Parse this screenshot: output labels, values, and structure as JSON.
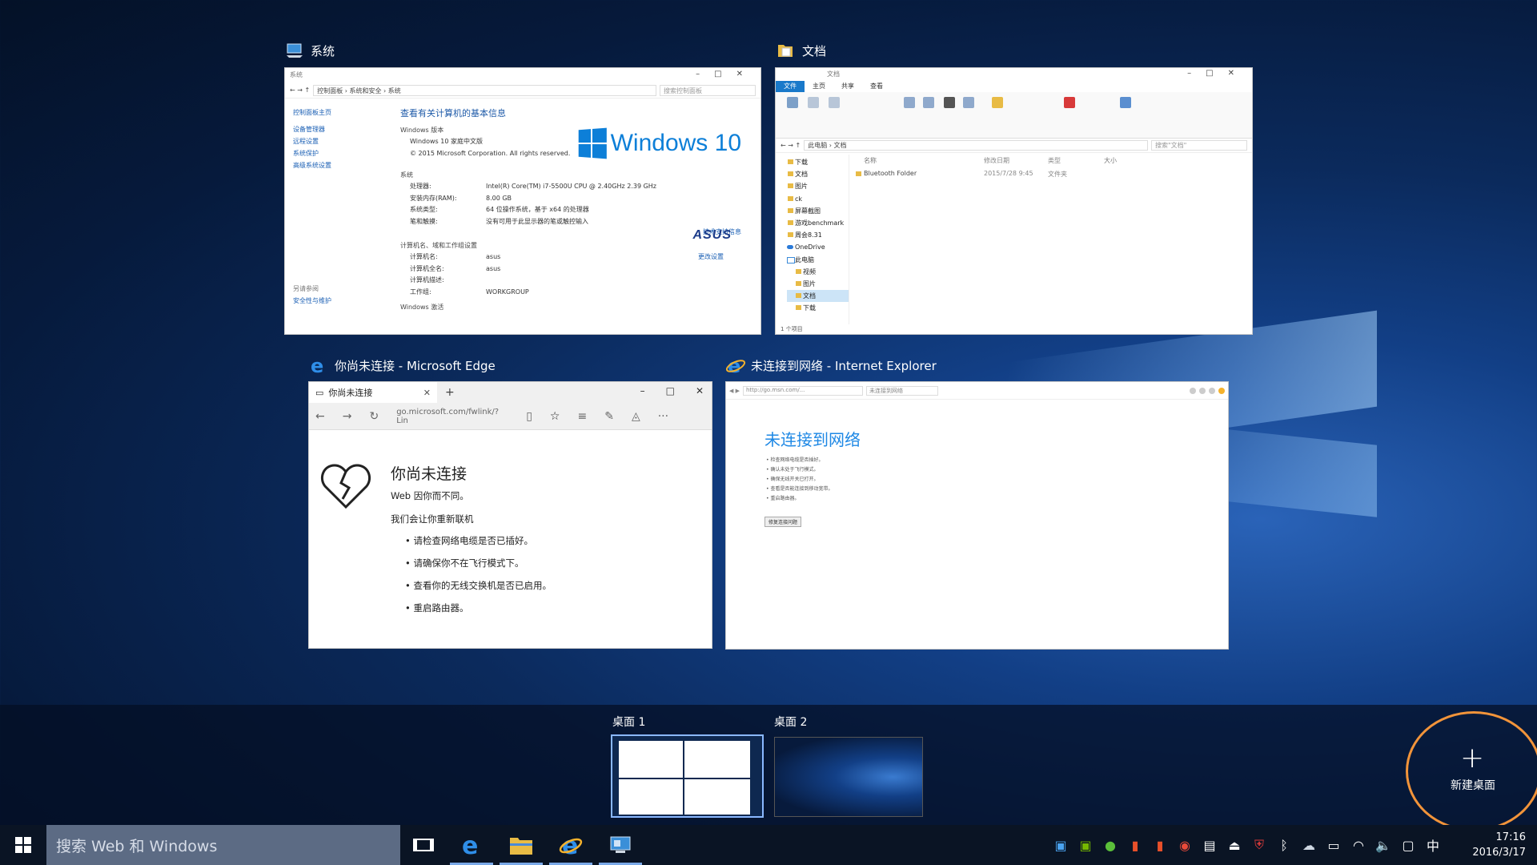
{
  "windows": {
    "system": {
      "title": "系统",
      "titlebar": "系统",
      "path": "控制面板 › 系统和安全 › 系统",
      "search_placeholder": "搜索控制面板",
      "left_links": [
        "控制面板主页",
        "设备管理器",
        "远程设置",
        "系统保护",
        "高级系统设置"
      ],
      "see_also": "另请参阅",
      "see_also_link": "安全性与维护",
      "heading": "查看有关计算机的基本信息",
      "edition_section": "Windows 版本",
      "edition": "Windows 10 家庭中文版",
      "copyright": "© 2015 Microsoft Corporation. All rights reserved.",
      "logo_text": "Windows 10",
      "system_section": "系统",
      "rows": [
        {
          "k": "处理器:",
          "v": "Intel(R) Core(TM) i7-5500U CPU @ 2.40GHz   2.39 GHz"
        },
        {
          "k": "安装内存(RAM):",
          "v": "8.00 GB"
        },
        {
          "k": "系统类型:",
          "v": "64 位操作系统，基于 x64 的处理器"
        },
        {
          "k": "笔和触摸:",
          "v": "没有可用于此显示器的笔或触控输入"
        }
      ],
      "support_link": "技术支持信息",
      "name_section": "计算机名、域和工作组设置",
      "name_rows": [
        {
          "k": "计算机名:",
          "v": "asus"
        },
        {
          "k": "计算机全名:",
          "v": "asus"
        },
        {
          "k": "计算机描述:",
          "v": ""
        },
        {
          "k": "工作组:",
          "v": "WORKGROUP"
        }
      ],
      "change_settings": "更改设置",
      "activation_section": "Windows 激活",
      "brand": "ASUS"
    },
    "documents": {
      "title": "文档",
      "titlebar": "文档",
      "ribbon_tabs": [
        "文件",
        "主页",
        "共享",
        "查看"
      ],
      "path": "此电脑 › 文档",
      "search_placeholder": "搜索\"文档\"",
      "nav": [
        "下载",
        "文档",
        "图片",
        "ck",
        "屏幕截图",
        "游戏benchmark",
        "周会8.31",
        "OneDrive",
        "此电脑",
        "视频",
        "图片",
        "文档",
        "下载"
      ],
      "columns": [
        "名称",
        "修改日期",
        "类型",
        "大小"
      ],
      "files": [
        {
          "name": "Bluetooth Folder",
          "date": "2015/7/28 9:45",
          "type": "文件夹"
        }
      ],
      "status": "1 个项目"
    },
    "edge": {
      "title": "你尚未连接 - Microsoft Edge",
      "tab_title": "你尚未连接",
      "url": "go.microsoft.com/fwlink/?Lin",
      "heading": "你尚未连接",
      "line1": "Web 因你而不同。",
      "line2": "我们会让你重新联机",
      "tips": [
        "请检查网络电缆是否已插好。",
        "请确保你不在飞行模式下。",
        "查看你的无线交换机是否已启用。",
        "重启路由器。"
      ]
    },
    "ie": {
      "title": "未连接到网络 - Internet Explorer",
      "url": "http://go.msn.com/...",
      "tab": "未连接到网络",
      "heading": "未连接到网络",
      "tips": [
        "检查网络电缆是否插好。",
        "确认未处于飞行模式。",
        "确保无线开关已打开。",
        "查看是否能连接到移动宽带。",
        "重启路由器。"
      ],
      "button": "修复连接问题"
    }
  },
  "desktops": [
    {
      "label": "桌面 1",
      "active": true
    },
    {
      "label": "桌面 2",
      "active": false
    }
  ],
  "new_desktop": "新建桌面",
  "taskbar": {
    "search_placeholder": "搜索 Web 和 Windows",
    "time": "17:16",
    "date": "2016/3/17",
    "ime": "中"
  }
}
